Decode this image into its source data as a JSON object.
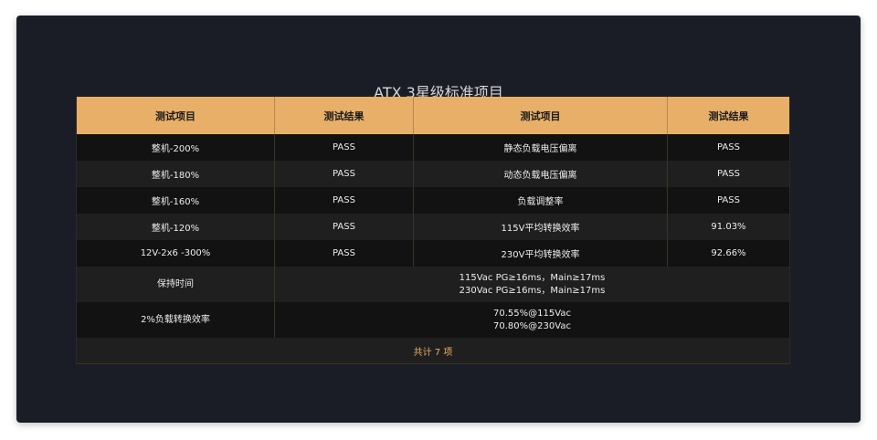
{
  "title": "ATX 3星级标准项目",
  "headers": [
    "测试项目",
    "测试结果",
    "测试项目",
    "测试结果"
  ],
  "rows": [
    [
      "整机-200%",
      "PASS",
      "静态负载电压偏离",
      "PASS"
    ],
    [
      "整机-180%",
      "PASS",
      "动态负载电压偏离",
      "PASS"
    ],
    [
      "整机-160%",
      "PASS",
      "负载调整率",
      "PASS"
    ],
    [
      "整机-120%",
      "PASS",
      "115V平均转换效率",
      "91.03%"
    ],
    [
      "12V-2x6 -300%",
      "PASS",
      "230V平均转换效率",
      "92.66%"
    ]
  ],
  "hold_time": {
    "label": "保持时间",
    "line1": "115Vac PG≥16ms，Main≥17ms",
    "line2": "230Vac PG≥16ms，Main≥17ms"
  },
  "efficiency_2pct": {
    "label": "2%负载转换效率",
    "line1": "70.55%@115Vac",
    "line2": "70.80%@230Vac"
  },
  "footer": "共计 7 项",
  "colors": {
    "header_bg": "#e8af68",
    "card_bg": "#1b1d26",
    "accent_text": "#e8af68"
  }
}
